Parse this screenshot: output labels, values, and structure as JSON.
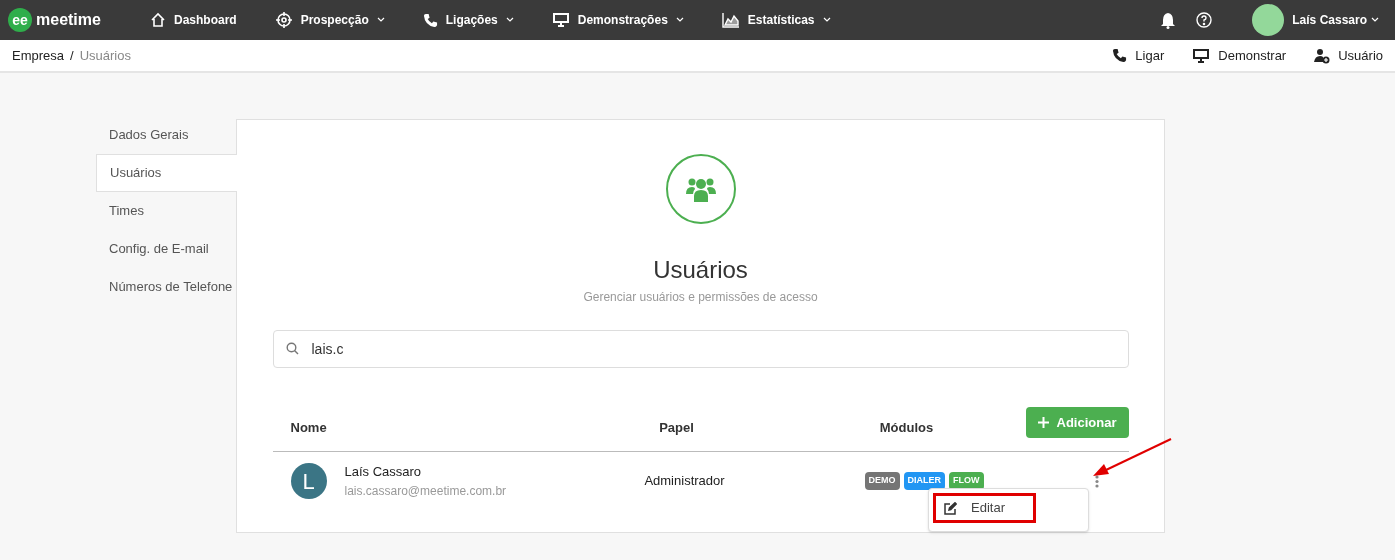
{
  "topbar": {
    "logo_mark": "ee",
    "logo_text": "meetime",
    "nav": [
      {
        "label": "Dashboard",
        "kind": "home",
        "dropdown": false
      },
      {
        "label": "Prospecção",
        "kind": "target",
        "dropdown": true
      },
      {
        "label": "Ligações",
        "kind": "phone",
        "dropdown": true
      },
      {
        "label": "Demonstrações",
        "kind": "monitor",
        "dropdown": true
      },
      {
        "label": "Estatísticas",
        "kind": "chart",
        "dropdown": true
      }
    ],
    "user": "Laís Cassaro"
  },
  "breadcrumb": {
    "separator": "/",
    "items": [
      "Empresa",
      "Usuários"
    ]
  },
  "actions": [
    {
      "label": "Ligar",
      "kind": "phone"
    },
    {
      "label": "Demonstrar",
      "kind": "monitor"
    },
    {
      "label": "Usuário",
      "kind": "user-add"
    }
  ],
  "sidebar": {
    "items": [
      {
        "label": "Dados Gerais",
        "selected": false
      },
      {
        "label": "Usuários",
        "selected": true
      },
      {
        "label": "Times",
        "selected": false
      },
      {
        "label": "Config. de E-mail",
        "selected": false
      },
      {
        "label": "Números de Telefone",
        "selected": false
      }
    ]
  },
  "header": {
    "title": "Usuários",
    "subtitle": "Gerenciar usuários e permissões de acesso"
  },
  "search": {
    "value": "lais.c"
  },
  "table": {
    "columns": [
      "Nome",
      "Papel",
      "Módulos"
    ],
    "add_button": "Adicionar",
    "rows": [
      {
        "initial": "L",
        "name": "Laís Cassaro",
        "email": "lais.cassaro@meetime.com.br",
        "role": "Administrador",
        "modules": [
          {
            "label": "DEMO",
            "color": "#757575"
          },
          {
            "label": "DIALER",
            "color": "#2196f3"
          },
          {
            "label": "FLOW",
            "color": "#4caf50"
          }
        ]
      }
    ]
  },
  "menu": {
    "items": [
      "Editar"
    ]
  }
}
